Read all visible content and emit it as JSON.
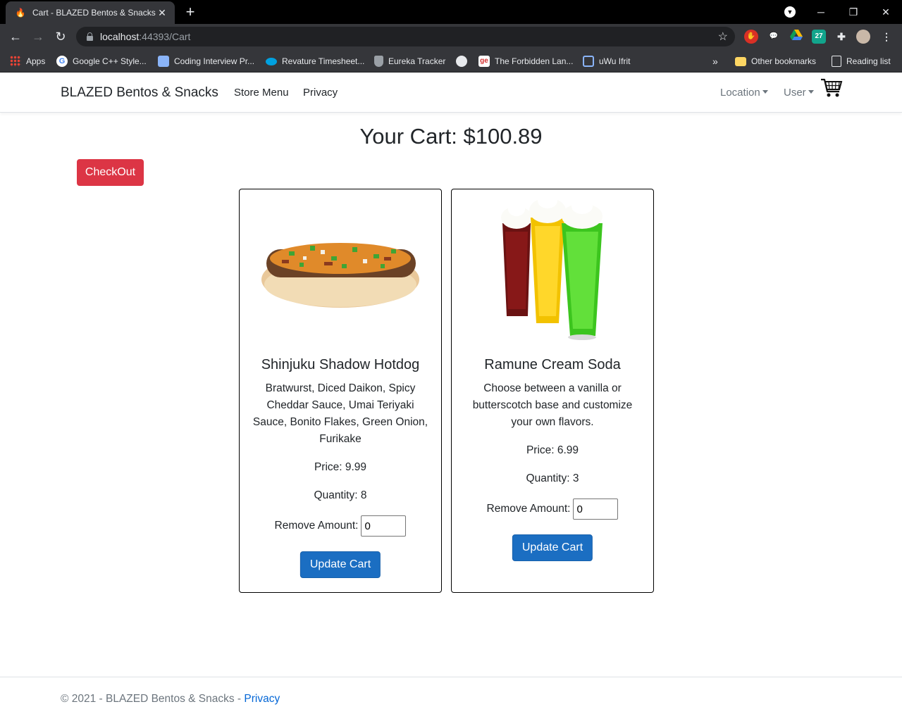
{
  "browser": {
    "tab_title": "Cart - BLAZED Bentos & Snacks",
    "tab_close": "✕",
    "new_tab": "+",
    "url_host": "localhost",
    "url_rest": ":44393/Cart",
    "bookmarks": [
      {
        "label": "Apps",
        "icon": "apps-grid-icon",
        "color": "#ea4335"
      },
      {
        "label": "Google C++ Style...",
        "icon": "google-icon",
        "color": "#4285f4"
      },
      {
        "label": "Coding Interview Pr...",
        "icon": "layers-icon",
        "color": "#8ab4f8"
      },
      {
        "label": "Revature Timesheet...",
        "icon": "salesforce-cloud-icon",
        "color": "#00a1e0"
      },
      {
        "label": "Eureka Tracker",
        "icon": "shield-icon",
        "color": "#9aa0a6"
      },
      {
        "label": "",
        "icon": "globe-icon",
        "color": "#e8eaed"
      },
      {
        "label": "The Forbidden Lan...",
        "icon": "ge-icon",
        "color": "#d32f2f"
      },
      {
        "label": "uWu Ifrit",
        "icon": "twitch-icon",
        "color": "#8ab4f8"
      }
    ],
    "more_bookmarks": "»",
    "other_bookmarks": "Other bookmarks",
    "reading_list": "Reading list"
  },
  "nav": {
    "brand": "BLAZED Bentos & Snacks",
    "links": [
      "Store Menu",
      "Privacy"
    ],
    "location": "Location",
    "user": "User"
  },
  "page": {
    "title": "Your Cart: $100.89",
    "checkout": "CheckOut"
  },
  "items": [
    {
      "name": "Shinjuku Shadow Hotdog",
      "description": "Bratwurst, Diced Daikon, Spicy Cheddar Sauce, Umai Teriyaki Sauce, Bonito Flakes, Green Onion, Furikake",
      "price": "Price: 9.99",
      "quantity": "Quantity: 8",
      "remove_label": "Remove Amount:",
      "remove_value": "0",
      "update": "Update Cart"
    },
    {
      "name": "Ramune Cream Soda",
      "description": "Choose between a vanilla or butterscotch base and customize your own flavors.",
      "price": "Price: 6.99",
      "quantity": "Quantity: 3",
      "remove_label": "Remove Amount:",
      "remove_value": "0",
      "update": "Update Cart"
    }
  ],
  "footer": {
    "text": "© 2021 - BLAZED Bentos & Snacks - ",
    "link": "Privacy"
  },
  "colors": {
    "danger": "#dc3545",
    "primary": "#1b6ec2",
    "link": "#0366d6",
    "muted": "#6c757d"
  }
}
